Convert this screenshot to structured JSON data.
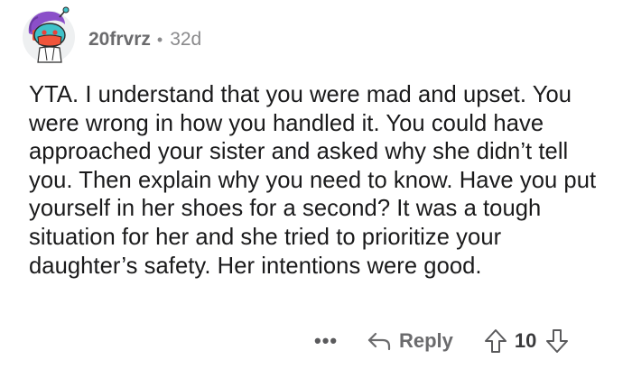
{
  "comment": {
    "username": "20frvrz",
    "separator": "•",
    "age": "32d",
    "avatar_icon": "reddit-snoo-avatar-icon",
    "text": "YTA. I understand that you were mad and upset. You were wrong in how you handled it. You could have approached your sister and asked why she didn’t tell you. Then explain why you need to know. Have you put yourself in her shoes for a second? It was a tough situation for her and she tried to prioritize your daughter’s safety. Her intentions were good.",
    "actions": {
      "more_label": "•••",
      "reply_label": "Reply",
      "reply_icon": "reply-arrow-icon",
      "score": "10",
      "upvote_icon": "upvote-arrow-icon",
      "downvote_icon": "downvote-arrow-icon"
    }
  },
  "colors": {
    "avatar_hair": "#8b4fc9",
    "avatar_face": "#3fc2c9",
    "avatar_mask": "#f0553b",
    "meta_text": "#8a8a8c",
    "body_text": "#1a1a1b"
  }
}
